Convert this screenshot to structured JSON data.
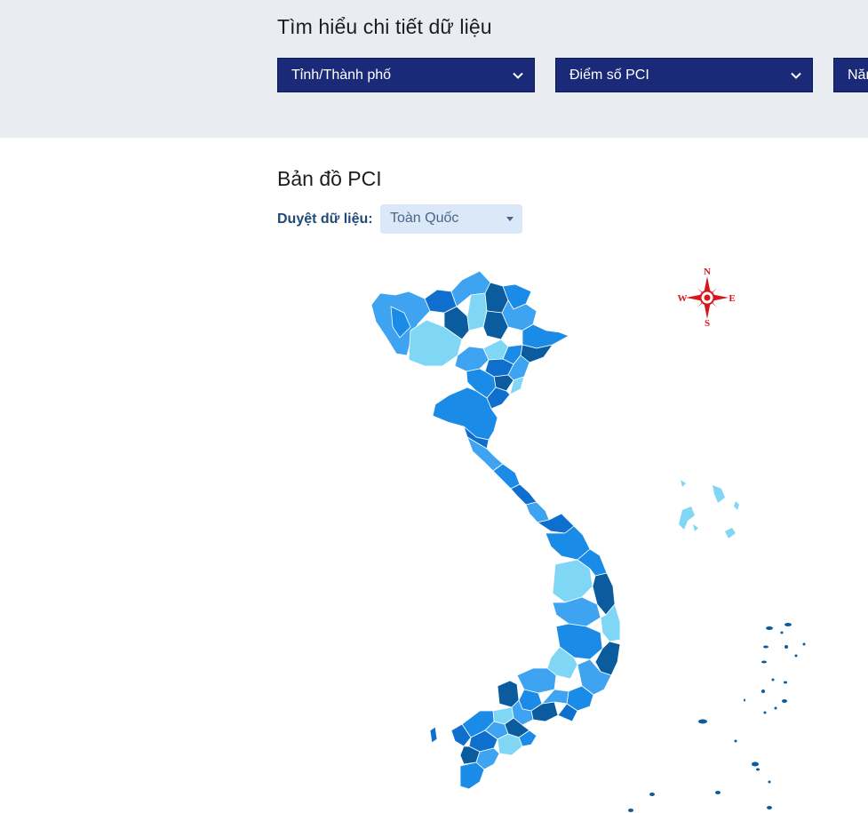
{
  "explore": {
    "title": "Tìm hiểu chi tiết dữ liệu",
    "filters": [
      "Tỉnh/Thành phố",
      "Điểm số PCI",
      "Năm"
    ]
  },
  "map_section": {
    "title": "Bản đồ PCI",
    "browse_label": "Duyệt dữ liệu:",
    "scope_value": "Toàn Quốc"
  },
  "compass": {
    "n": "N",
    "s": "S",
    "e": "E",
    "w": "W",
    "color": "#d7151a"
  },
  "palette": [
    "#7fd6f5",
    "#3ea3f0",
    "#1a8be6",
    "#0f6fce",
    "#0b5c9f"
  ]
}
